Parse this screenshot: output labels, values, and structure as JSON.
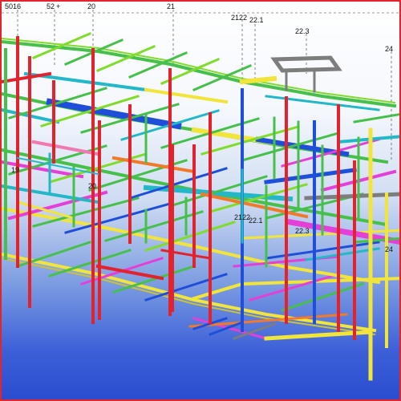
{
  "viewport": {
    "title": "3D structural model view",
    "background_top": "#ffffff",
    "background_bottom": "#2a4dcf",
    "border_color": "#e0262a"
  },
  "grid_labels": {
    "top_5016": "5016",
    "top_52": "52",
    "top_plus": "+",
    "top_20": "20",
    "top_21": "21",
    "top_2122": "2122",
    "top_221": "22.1",
    "top_223": "22.3",
    "right_24": "24",
    "mid_19": "19",
    "mid_20": "20",
    "mid_2122": "2122",
    "mid_221": "22.1",
    "mid_223": "22.3",
    "right_24b": "24"
  },
  "member_colors": {
    "column": "#e2232e",
    "beam_green": "#46c04a",
    "beam_lime": "#7fdc2a",
    "beam_blue": "#1f4fd9",
    "beam_magenta": "#e43fd6",
    "beam_cyan": "#22b8c8",
    "beam_yellow": "#f1e43a",
    "beam_orange": "#f07a2a",
    "beam_gray": "#7d7d7d",
    "beam_olive": "#a9a33a",
    "beam_pink": "#f07ab0"
  }
}
